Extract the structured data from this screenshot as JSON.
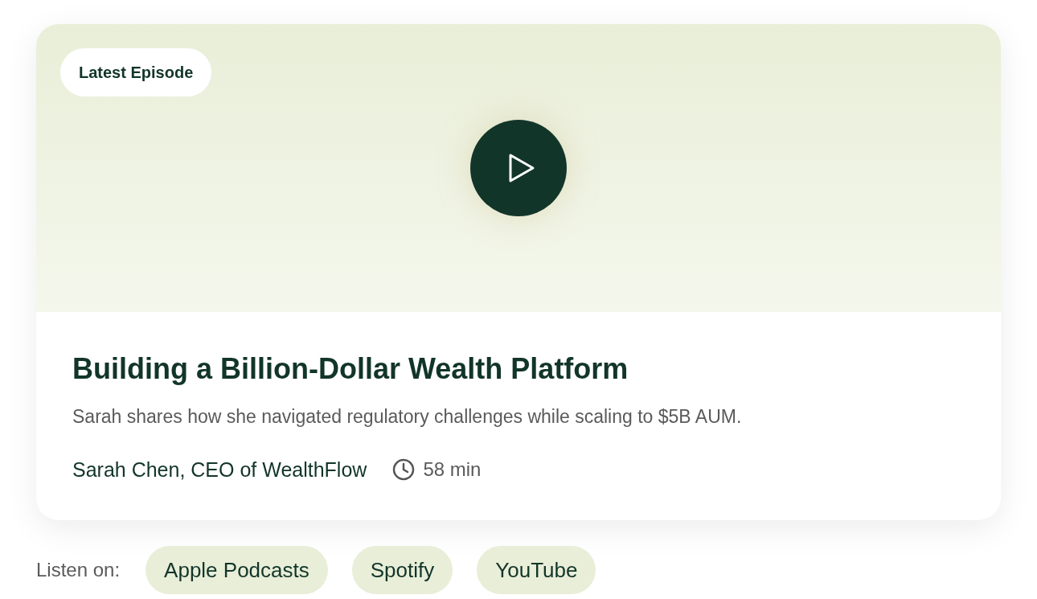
{
  "episode": {
    "badge": "Latest Episode",
    "title": "Building a Billion-Dollar Wealth Platform",
    "description": "Sarah shares how she navigated regulatory challenges while scaling to $5B AUM.",
    "guest": "Sarah Chen, CEO of WealthFlow",
    "duration": "58 min"
  },
  "listen": {
    "label": "Listen on:",
    "platforms": [
      "Apple Podcasts",
      "Spotify",
      "YouTube"
    ]
  }
}
